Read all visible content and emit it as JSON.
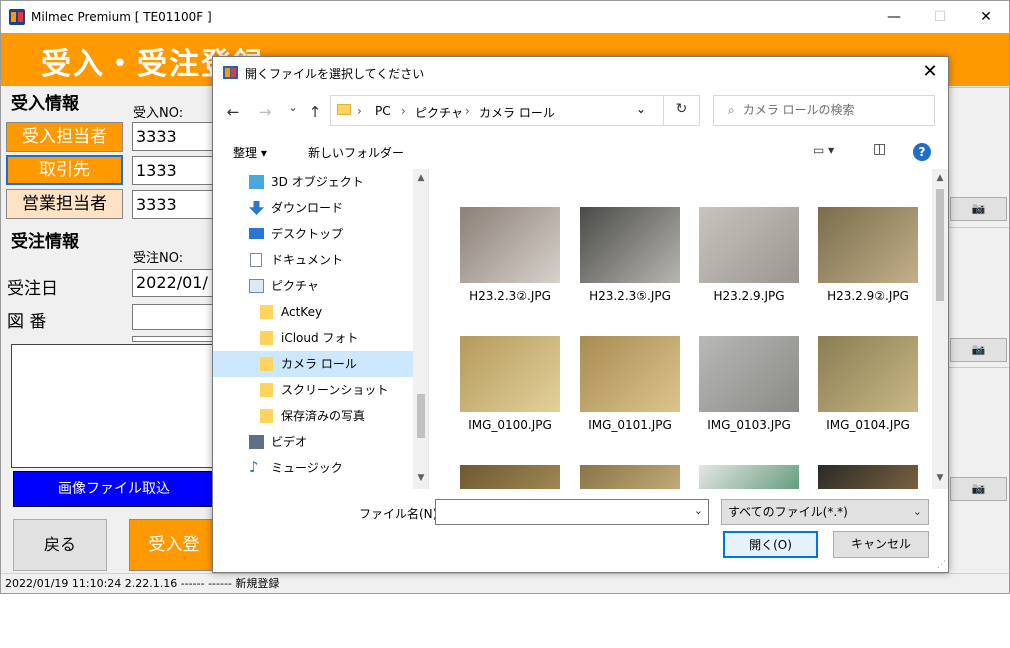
{
  "window": {
    "title": "Milmec Premium [ TE01100F ]",
    "minimize": "—",
    "maximize": "☐",
    "close": "✕"
  },
  "banner": {
    "title": "受入・受注登録"
  },
  "receive": {
    "section": "受入情報",
    "no_label": "受入NO:",
    "receiver_btn": "受入担当者",
    "receiver_value": "3333",
    "client_btn": "取引先",
    "client_value": "1333",
    "sales_btn": "営業担当者",
    "sales_value": "3333"
  },
  "order": {
    "section": "受注情報",
    "no_label": "受注NO:",
    "date_label": "受注日",
    "date_value": "2022/01/",
    "drawing_label": "図 番",
    "drawing_value": ""
  },
  "image_import_btn": "画像ファイル取込",
  "back_btn": "戻る",
  "register_btn": "受入登",
  "camera_btn": "📷",
  "status": "2022/01/19 11:10:24  2.22.1.16  ------  ------ 新規登録",
  "dialog": {
    "title": "開くファイルを選択してください",
    "close": "✕",
    "nav": {
      "back": "←",
      "forward": "→",
      "recent": "⌄",
      "up": "↑"
    },
    "breadcrumb": [
      "PC",
      "ピクチャ",
      "カメラ ロール"
    ],
    "sep": "›",
    "addr_chevron": "⌄",
    "refresh": "↻",
    "search_placeholder": "カメラ ロールの検索",
    "search_icon": "⌕",
    "toolbar": {
      "organize": "整理 ▾",
      "new_folder": "新しいフォルダー"
    },
    "view_icon": "▭ ▾",
    "pane_icon": "◫",
    "help": "?",
    "nav_pane": [
      {
        "label": "3D オブジェクト",
        "icon": "cube-icon",
        "color": "#4aa8e0"
      },
      {
        "label": "ダウンロード",
        "icon": "download-icon",
        "color": "#2b76d2"
      },
      {
        "label": "デスクトップ",
        "icon": "desktop-icon",
        "color": "#2b76d2"
      },
      {
        "label": "ドキュメント",
        "icon": "document-icon",
        "color": "#7a8aa0"
      },
      {
        "label": "ピクチャ",
        "icon": "pictures-icon",
        "color": "#5f8ec5"
      },
      {
        "label": "ActKey",
        "icon": "folder-icon",
        "color": "#ffd35c"
      },
      {
        "label": "iCloud フォト",
        "icon": "folder-icon",
        "color": "#ffd35c"
      },
      {
        "label": "カメラ ロール",
        "icon": "folder-icon",
        "color": "#ffd35c"
      },
      {
        "label": "スクリーンショット",
        "icon": "folder-icon",
        "color": "#ffd35c"
      },
      {
        "label": "保存済みの写真",
        "icon": "folder-icon",
        "color": "#ffd35c"
      },
      {
        "label": "ビデオ",
        "icon": "video-icon",
        "color": "#5f6f85"
      },
      {
        "label": "ミュージック",
        "icon": "music-icon",
        "color": "#2b76d2"
      }
    ],
    "files": [
      {
        "name": "H23.2.3②.JPG",
        "c1": "#8c8078",
        "c2": "#d8d2cc"
      },
      {
        "name": "H23.2.3⑤.JPG",
        "c1": "#4a4a48",
        "c2": "#b8b6b0"
      },
      {
        "name": "H23.2.9.JPG",
        "c1": "#c8c4be",
        "c2": "#9a968f"
      },
      {
        "name": "H23.2.9②.JPG",
        "c1": "#7a6c4c",
        "c2": "#c2b089"
      },
      {
        "name": "IMG_0100.JPG",
        "c1": "#b49a5c",
        "c2": "#e3d19a"
      },
      {
        "name": "IMG_0101.JPG",
        "c1": "#a88c52",
        "c2": "#dcc58c"
      },
      {
        "name": "IMG_0103.JPG",
        "c1": "#b8b8b6",
        "c2": "#8a8a86"
      },
      {
        "name": "IMG_0104.JPG",
        "c1": "#8a7d52",
        "c2": "#c9b888"
      },
      {
        "name": "",
        "c1": "#6e5a32",
        "c2": "#b4985e"
      },
      {
        "name": "",
        "c1": "#8a7548",
        "c2": "#d8c08a"
      },
      {
        "name": "",
        "c1": "#e6e6e2",
        "c2": "#2f7f57"
      },
      {
        "name": "",
        "c1": "#2a2a28",
        "c2": "#9a7a44"
      }
    ],
    "filename_label": "ファイル名(N):",
    "filename_value": "",
    "filetype": "すべてのファイル(*.*)",
    "open_btn": "開く(O)",
    "cancel_btn": "キャンセル"
  }
}
